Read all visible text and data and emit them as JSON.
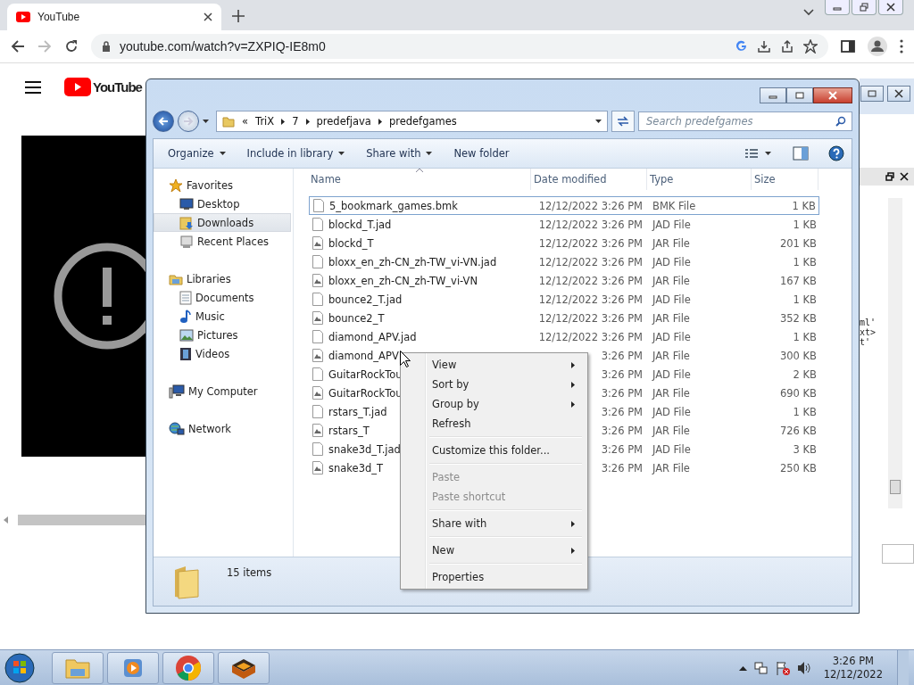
{
  "browser": {
    "tab": {
      "title": "YouTube"
    },
    "url": "youtube.com/watch?v=ZXPIQ-IE8m0"
  },
  "youtube": {
    "logo": "YouTube"
  },
  "explorer": {
    "breadcrumb": [
      "«",
      "TriX",
      "7",
      "predefjava",
      "predefgames"
    ],
    "search": {
      "placeholder": "Search predefgames"
    },
    "toolbar": [
      {
        "label": "Organize",
        "dropdown": true
      },
      {
        "label": "Include in library",
        "dropdown": true
      },
      {
        "label": "Share with",
        "dropdown": true
      },
      {
        "label": "New folder",
        "dropdown": false
      }
    ],
    "nav": [
      {
        "label": "Favorites",
        "kind": "star",
        "selected": false,
        "children": [
          {
            "label": "Desktop",
            "kind": "desktop",
            "selected": false
          },
          {
            "label": "Downloads",
            "kind": "downloads",
            "selected": true
          },
          {
            "label": "Recent Places",
            "kind": "recent",
            "selected": false
          }
        ]
      },
      {
        "label": "Libraries",
        "kind": "library",
        "selected": false,
        "children": [
          {
            "label": "Documents",
            "kind": "documents",
            "selected": false
          },
          {
            "label": "Music",
            "kind": "music",
            "selected": false
          },
          {
            "label": "Pictures",
            "kind": "pictures",
            "selected": false
          },
          {
            "label": "Videos",
            "kind": "videos",
            "selected": false
          }
        ]
      },
      {
        "label": "My Computer",
        "kind": "computer",
        "selected": false
      },
      {
        "label": "Network",
        "kind": "network",
        "selected": false
      }
    ],
    "columns": [
      "Name",
      "Date modified",
      "Type",
      "Size"
    ],
    "rows": [
      {
        "name": "5_bookmark_games.bmk",
        "date": "12/12/2022 3:26 PM",
        "type": "BMK File",
        "size": "1 KB",
        "kind": "plain",
        "selected": true
      },
      {
        "name": "blockd_T.jad",
        "date": "12/12/2022 3:26 PM",
        "type": "JAD File",
        "size": "1 KB",
        "kind": "plain",
        "selected": false
      },
      {
        "name": "blockd_T",
        "date": "12/12/2022 3:26 PM",
        "type": "JAR File",
        "size": "201 KB",
        "kind": "jar",
        "selected": false
      },
      {
        "name": "bloxx_en_zh-CN_zh-TW_vi-VN.jad",
        "date": "12/12/2022 3:26 PM",
        "type": "JAD File",
        "size": "1 KB",
        "kind": "plain",
        "selected": false
      },
      {
        "name": "bloxx_en_zh-CN_zh-TW_vi-VN",
        "date": "12/12/2022 3:26 PM",
        "type": "JAR File",
        "size": "167 KB",
        "kind": "jar",
        "selected": false
      },
      {
        "name": "bounce2_T.jad",
        "date": "12/12/2022 3:26 PM",
        "type": "JAD File",
        "size": "1 KB",
        "kind": "plain",
        "selected": false
      },
      {
        "name": "bounce2_T",
        "date": "12/12/2022 3:26 PM",
        "type": "JAR File",
        "size": "352 KB",
        "kind": "jar",
        "selected": false
      },
      {
        "name": "diamond_APV.jad",
        "date": "12/12/2022 3:26 PM",
        "type": "JAD File",
        "size": "1 KB",
        "kind": "plain",
        "selected": false
      },
      {
        "name": "diamond_APV",
        "date": "3:26 PM",
        "type": "JAR File",
        "size": "300 KB",
        "kind": "jar",
        "selected": false
      },
      {
        "name": "GuitarRockTou",
        "date": "3:26 PM",
        "type": "JAD File",
        "size": "2 KB",
        "kind": "plain",
        "selected": false
      },
      {
        "name": "GuitarRockTou",
        "date": "3:26 PM",
        "type": "JAR File",
        "size": "690 KB",
        "kind": "jar",
        "selected": false
      },
      {
        "name": "rstars_T.jad",
        "date": "3:26 PM",
        "type": "JAD File",
        "size": "1 KB",
        "kind": "plain",
        "selected": false
      },
      {
        "name": "rstars_T",
        "date": "3:26 PM",
        "type": "JAR File",
        "size": "726 KB",
        "kind": "jar",
        "selected": false
      },
      {
        "name": "snake3d_T.jad",
        "date": "3:26 PM",
        "type": "JAD File",
        "size": "3 KB",
        "kind": "plain",
        "selected": false
      },
      {
        "name": "snake3d_T",
        "date": "3:26 PM",
        "type": "JAR File",
        "size": "250 KB",
        "kind": "jar",
        "selected": false
      }
    ],
    "status": "15 items"
  },
  "context_menu": {
    "groups": [
      [
        {
          "label": "View",
          "submenu": true,
          "disabled": false
        },
        {
          "label": "Sort by",
          "submenu": true,
          "disabled": false
        },
        {
          "label": "Group by",
          "submenu": true,
          "disabled": false
        },
        {
          "label": "Refresh",
          "submenu": false,
          "disabled": false
        }
      ],
      [
        {
          "label": "Customize this folder...",
          "submenu": false,
          "disabled": false
        }
      ],
      [
        {
          "label": "Paste",
          "submenu": false,
          "disabled": true
        },
        {
          "label": "Paste shortcut",
          "submenu": false,
          "disabled": true
        }
      ],
      [
        {
          "label": "Share with",
          "submenu": true,
          "disabled": false
        }
      ],
      [
        {
          "label": "New",
          "submenu": true,
          "disabled": false
        }
      ],
      [
        {
          "label": "Properties",
          "submenu": false,
          "disabled": false
        }
      ]
    ]
  },
  "back_window": {
    "code_lines": [
      "ml'",
      "xt>",
      "t'"
    ]
  },
  "taskbar": {
    "time": "3:26 PM",
    "date": "12/12/2022"
  }
}
